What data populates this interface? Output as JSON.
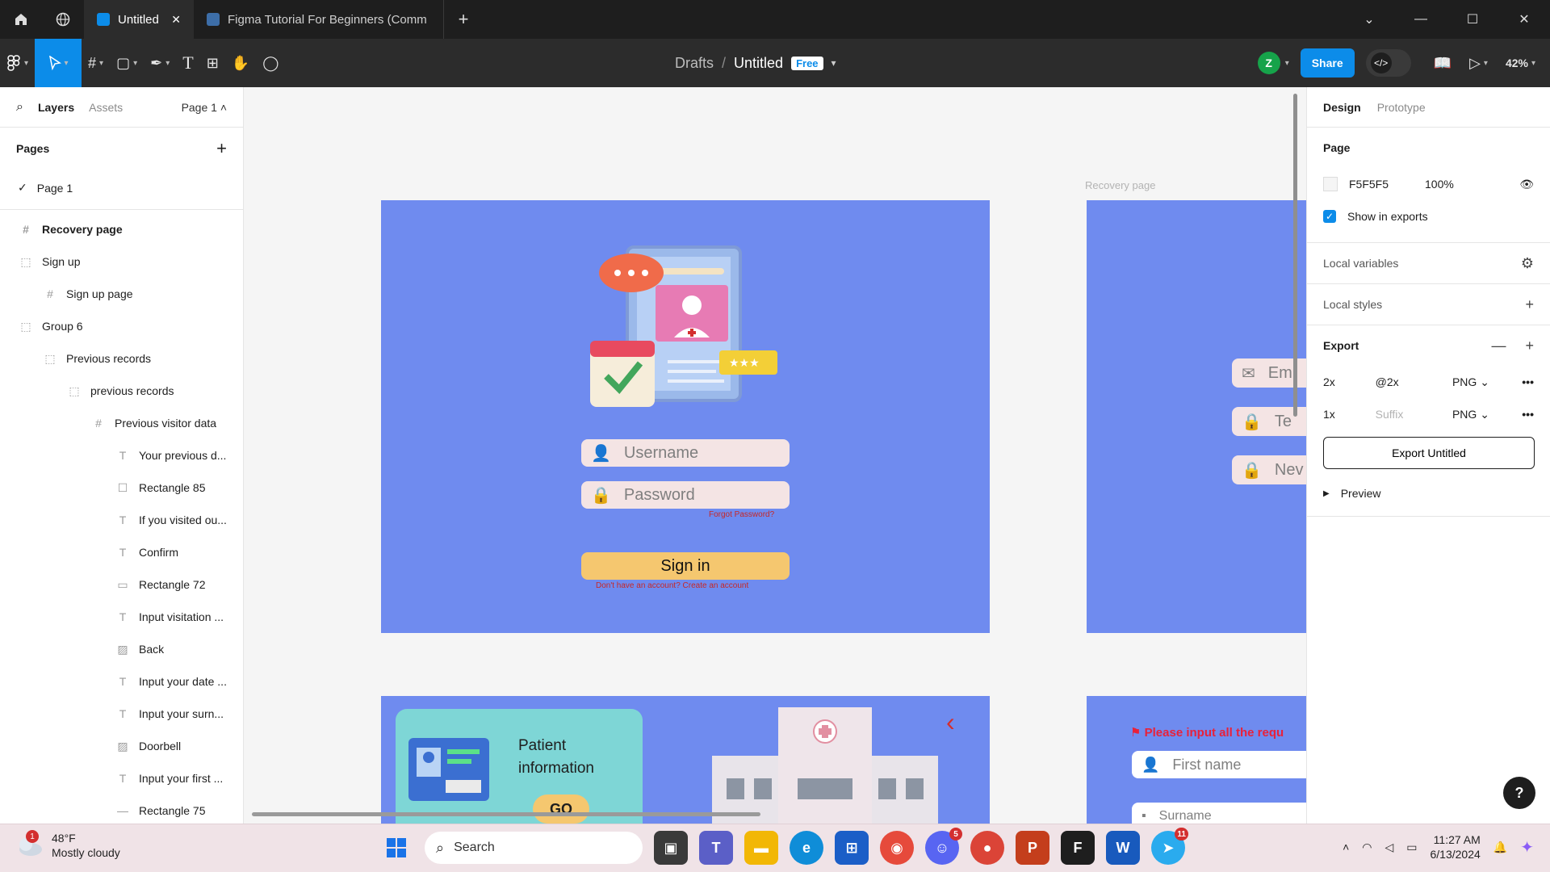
{
  "titlebar": {
    "tab_active": "Untitled",
    "tab_inactive": "Figma Tutorial For Beginners (Comm",
    "close": "✕",
    "add": "+",
    "minimize": "—",
    "maximize": "☐",
    "window_close": "✕",
    "chevron": "⌄"
  },
  "toolbar": {
    "breadcrumb_drafts": "Drafts",
    "breadcrumb_sep": "/",
    "file_name": "Untitled",
    "plan_badge": "Free",
    "avatar_initial": "Z",
    "share_label": "Share",
    "zoom": "42%"
  },
  "left_panel": {
    "tab_layers": "Layers",
    "tab_assets": "Assets",
    "page_select": "Page 1 ˄",
    "pages_header": "Pages",
    "pages_add": "+",
    "pages": [
      {
        "label": "Page 1",
        "check": "✓"
      }
    ],
    "layers": [
      {
        "label": "Recovery page",
        "icon": "#"
      },
      {
        "label": "Sign up",
        "icon": "⬚"
      },
      {
        "label": "Sign up page",
        "icon": "#"
      },
      {
        "label": "Group 6",
        "icon": "⬚"
      },
      {
        "label": "Previous records",
        "icon": "⬚"
      },
      {
        "label": "previous records",
        "icon": "⬚"
      },
      {
        "label": "Previous visitor data",
        "icon": "#"
      },
      {
        "label": "Your previous d...",
        "icon": "T"
      },
      {
        "label": "Rectangle 85",
        "icon": "☐"
      },
      {
        "label": "If you visited ou...",
        "icon": "T"
      },
      {
        "label": "Confirm",
        "icon": "T"
      },
      {
        "label": "Rectangle 72",
        "icon": "▭"
      },
      {
        "label": "Input visitation ...",
        "icon": "T"
      },
      {
        "label": "Back",
        "icon": "▨"
      },
      {
        "label": "Input your date ...",
        "icon": "T"
      },
      {
        "label": "Input your surn...",
        "icon": "T"
      },
      {
        "label": "Doorbell",
        "icon": "▨"
      },
      {
        "label": "Input your first ...",
        "icon": "T"
      },
      {
        "label": "Rectangle 75",
        "icon": "—"
      }
    ]
  },
  "canvas": {
    "frame_label_recovery": "Recovery page",
    "username_placeholder": "Username",
    "password_placeholder": "Password",
    "forgot_password": "Forgot Password?",
    "signin_label": "Sign in",
    "no_account": "Don't have an account? Create an account",
    "partial_email": "Em",
    "partial_temp": "Te",
    "partial_new": "Nev",
    "patient_info": "Patient information",
    "go_label": "GO",
    "back_chevron": "‹",
    "please_input": "Please input all the requ",
    "first_name": "First name",
    "surname": "Surname"
  },
  "right_panel": {
    "tab_design": "Design",
    "tab_prototype": "Prototype",
    "page_section": "Page",
    "page_color": "F5F5F5",
    "page_opacity": "100%",
    "show_in_exports": "Show in exports",
    "local_variables": "Local variables",
    "local_styles": "Local styles",
    "export_section": "Export",
    "export_rows": [
      {
        "scale": "2x",
        "suffix": "@2x",
        "format": "PNG ⌄"
      },
      {
        "scale": "1x",
        "suffix": "Suffix",
        "format": "PNG ⌄"
      }
    ],
    "export_button": "Export Untitled",
    "preview": "Preview",
    "help": "?"
  },
  "taskbar": {
    "weather_temp": "48°F",
    "weather_desc": "Mostly cloudy",
    "weather_badge": "1",
    "search_label": "Search",
    "discord_badge": "5",
    "telegram_badge": "11",
    "time": "11:27 AM",
    "date": "6/13/2024"
  },
  "colors": {
    "accent": "#0c8ce9",
    "frame_blue": "#6f8bef",
    "signin_yellow": "#f5c76f",
    "canvas_bg": "#F5F5F5"
  }
}
